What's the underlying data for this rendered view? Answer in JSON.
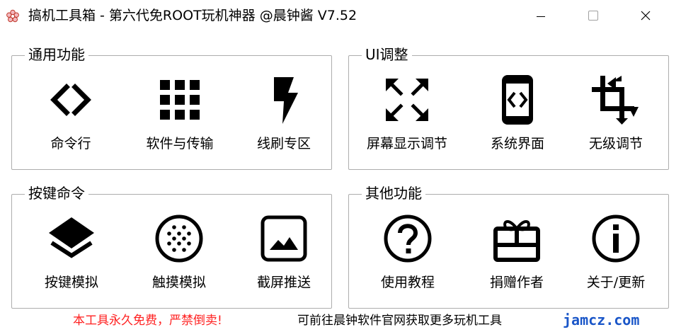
{
  "window": {
    "title": "搞机工具箱 - 第六代免ROOT玩机神器  @晨钟酱 V7.52",
    "icons": {
      "app": "flower-icon",
      "minimize": "minimize-icon",
      "maximize": "maximize-icon",
      "close": "close-icon"
    }
  },
  "groups": {
    "general": {
      "title": "通用功能",
      "items": [
        {
          "label": "命令行",
          "icon": "code-brackets-icon"
        },
        {
          "label": "软件与传输",
          "icon": "grid-icon"
        },
        {
          "label": "线刷专区",
          "icon": "lightning-icon"
        }
      ]
    },
    "ui": {
      "title": "UI调整",
      "items": [
        {
          "label": "屏幕显示调节",
          "icon": "expand-arrows-icon"
        },
        {
          "label": "系统界面",
          "icon": "phone-code-icon"
        },
        {
          "label": "无级调节",
          "icon": "crop-icon"
        }
      ]
    },
    "keys": {
      "title": "按键命令",
      "items": [
        {
          "label": "按键模拟",
          "icon": "layers-icon"
        },
        {
          "label": "触摸模拟",
          "icon": "touch-dots-icon"
        },
        {
          "label": "截屏推送",
          "icon": "image-icon"
        }
      ]
    },
    "other": {
      "title": "其他功能",
      "items": [
        {
          "label": "使用教程",
          "icon": "help-icon"
        },
        {
          "label": "捐赠作者",
          "icon": "gift-icon"
        },
        {
          "label": "关于/更新",
          "icon": "info-icon"
        }
      ]
    }
  },
  "footer": {
    "warning": "本工具永久免费，严禁倒卖!",
    "info": "可前往晨钟软件官网获取更多玩机工具",
    "link": "jamcz.com"
  },
  "colors": {
    "warning": "#ff2020",
    "link": "#1a56c8",
    "border": "#adadad"
  }
}
